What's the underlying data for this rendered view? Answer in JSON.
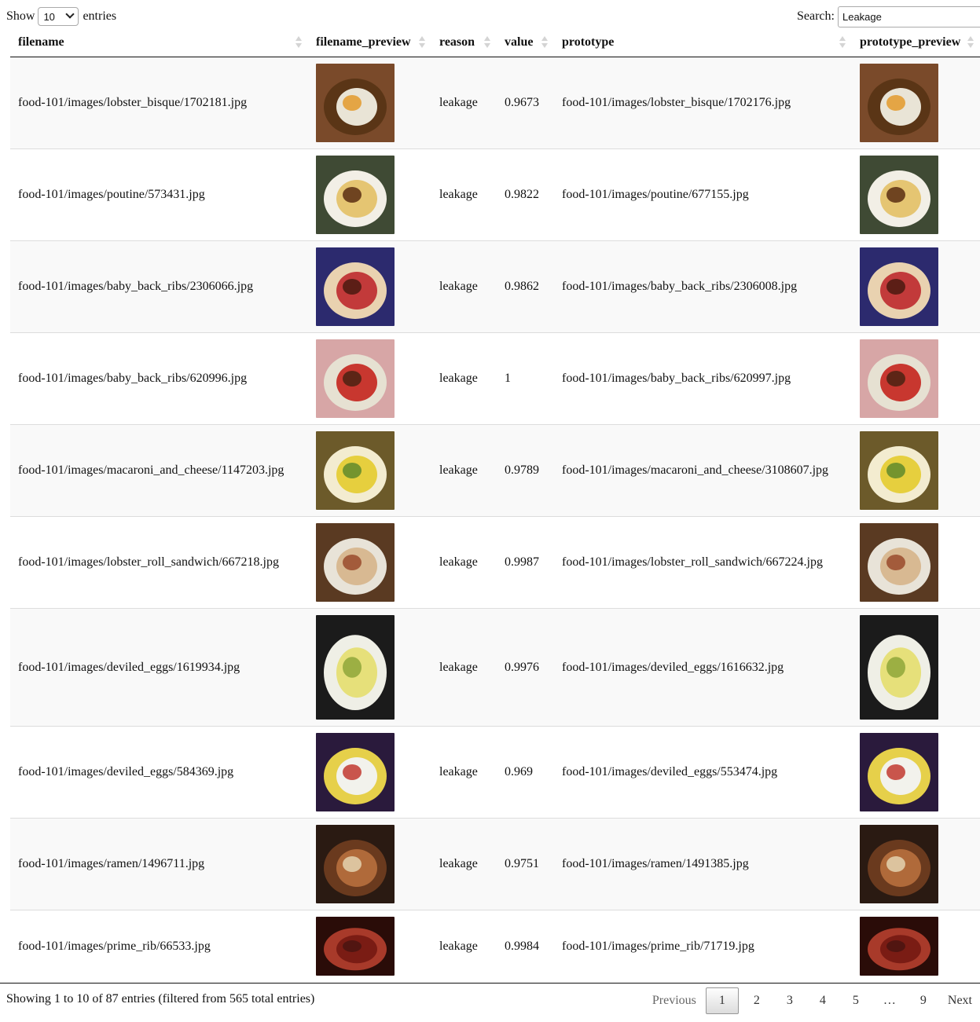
{
  "controls": {
    "show_label": "Show",
    "entries_label": "entries",
    "page_length": "10",
    "search_label": "Search:",
    "search_value": "Leakage"
  },
  "columns": [
    "filename",
    "filename_preview",
    "reason",
    "value",
    "prototype",
    "prototype_preview"
  ],
  "rows": [
    {
      "filename": "food-101/images/lobster_bisque/1702181.jpg",
      "reason": "leakage",
      "value": "0.9673",
      "prototype": "food-101/images/lobster_bisque/1702176.jpg",
      "preview": {
        "bg": "#7a4a2a",
        "a": "#e9e4d6",
        "b": "#e39a2c",
        "c": "#5a3516"
      }
    },
    {
      "filename": "food-101/images/poutine/573431.jpg",
      "reason": "leakage",
      "value": "0.9822",
      "prototype": "food-101/images/poutine/677155.jpg",
      "preview": {
        "bg": "#3f4a34",
        "a": "#e5c572",
        "b": "#5b2d12",
        "c": "#f2efe6"
      }
    },
    {
      "filename": "food-101/images/baby_back_ribs/2306066.jpg",
      "reason": "leakage",
      "value": "0.9862",
      "prototype": "food-101/images/baby_back_ribs/2306008.jpg",
      "preview": {
        "bg": "#2c2a6e",
        "a": "#c23a3a",
        "b": "#4a1a10",
        "c": "#e9d2b0"
      }
    },
    {
      "filename": "food-101/images/baby_back_ribs/620996.jpg",
      "reason": "leakage",
      "value": "1",
      "prototype": "food-101/images/baby_back_ribs/620997.jpg",
      "preview": {
        "bg": "#d7a6a6",
        "a": "#c8372f",
        "b": "#4a2212",
        "c": "#e6e1d2"
      }
    },
    {
      "filename": "food-101/images/macaroni_and_cheese/1147203.jpg",
      "reason": "leakage",
      "value": "0.9789",
      "prototype": "food-101/images/macaroni_and_cheese/3108607.jpg",
      "preview": {
        "bg": "#6c5a2a",
        "a": "#e6cf3e",
        "b": "#5f8a2c",
        "c": "#f3ecd0"
      }
    },
    {
      "filename": "food-101/images/lobster_roll_sandwich/667218.jpg",
      "reason": "leakage",
      "value": "0.9987",
      "prototype": "food-101/images/lobster_roll_sandwich/667224.jpg",
      "preview": {
        "bg": "#5a3a22",
        "a": "#d8b992",
        "b": "#9a4a2c",
        "c": "#e8e3d8"
      }
    },
    {
      "filename": "food-101/images/deviled_eggs/1619934.jpg",
      "reason": "leakage",
      "value": "0.9976",
      "prototype": "food-101/images/deviled_eggs/1616632.jpg",
      "preview": {
        "bg": "#1b1b1b",
        "a": "#e6e07a",
        "b": "#8ea63a",
        "c": "#efefe6"
      }
    },
    {
      "filename": "food-101/images/deviled_eggs/584369.jpg",
      "reason": "leakage",
      "value": "0.969",
      "prototype": "food-101/images/deviled_eggs/553474.jpg",
      "preview": {
        "bg": "#2a1a3c",
        "a": "#f2f2ec",
        "b": "#c23a30",
        "c": "#e6d04a"
      }
    },
    {
      "filename": "food-101/images/ramen/1496711.jpg",
      "reason": "leakage",
      "value": "0.9751",
      "prototype": "food-101/images/ramen/1491385.jpg",
      "preview": {
        "bg": "#2a1a12",
        "a": "#b06a3a",
        "b": "#e4d2b0",
        "c": "#6a3a1e"
      }
    },
    {
      "filename": "food-101/images/prime_rib/66533.jpg",
      "reason": "leakage",
      "value": "0.9984",
      "prototype": "food-101/images/prime_rib/71719.jpg",
      "preview": {
        "bg": "#2a0c08",
        "a": "#7a1c14",
        "b": "#4a1410",
        "c": "#a83a2a"
      }
    }
  ],
  "footer": {
    "info": "Showing 1 to 10 of 87 entries (filtered from 565 total entries)",
    "previous": "Previous",
    "next": "Next",
    "pages": [
      "1",
      "2",
      "3",
      "4",
      "5",
      "…",
      "9"
    ],
    "current_page": "1"
  }
}
